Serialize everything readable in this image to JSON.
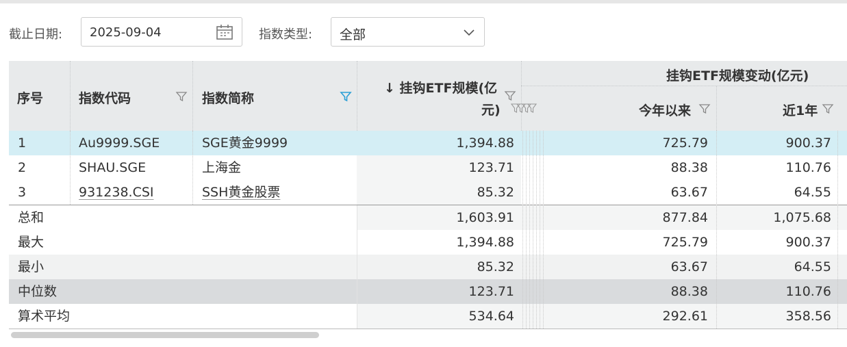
{
  "filters": {
    "date_label": "截止日期:",
    "date_value": "2025-09-04",
    "type_label": "指数类型:",
    "type_value": "全部"
  },
  "table": {
    "headers": {
      "seq": "序号",
      "code": "指数代码",
      "name": "指数简称",
      "scale_line1": "↓ 挂钩ETF规模(亿",
      "scale_line2": "元)",
      "change_group": "挂钩ETF规模变动(亿元)",
      "ytd": "今年以来",
      "y1": "近1年"
    },
    "rows": [
      {
        "seq": "1",
        "code": "Au9999.SGE",
        "name": "SGE黄金9999",
        "scale": "1,394.88",
        "ytd": "725.79",
        "y1": "900.37"
      },
      {
        "seq": "2",
        "code": "SHAU.SGE",
        "name": "上海金",
        "scale": "123.71",
        "ytd": "88.38",
        "y1": "110.76"
      },
      {
        "seq": "3",
        "code": "931238.CSI",
        "name": "SSH黄金股票",
        "scale": "85.32",
        "ytd": "63.67",
        "y1": "64.55"
      }
    ],
    "summary": [
      {
        "label": "总和",
        "scale": "1,603.91",
        "ytd": "877.84",
        "y1": "1,075.68"
      },
      {
        "label": "最大",
        "scale": "1,394.88",
        "ytd": "725.79",
        "y1": "900.37"
      },
      {
        "label": "最小",
        "scale": "85.32",
        "ytd": "63.67",
        "y1": "64.55"
      },
      {
        "label": "中位数",
        "scale": "123.71",
        "ytd": "88.38",
        "y1": "110.76"
      },
      {
        "label": "算术平均",
        "scale": "534.64",
        "ytd": "292.61",
        "y1": "358.56"
      }
    ]
  },
  "colors": {
    "header_bg": "#e8eaeb",
    "selected_row": "#d4eef5",
    "median_row": "#d9dbdd",
    "accent_filter": "#2a9fd6"
  }
}
